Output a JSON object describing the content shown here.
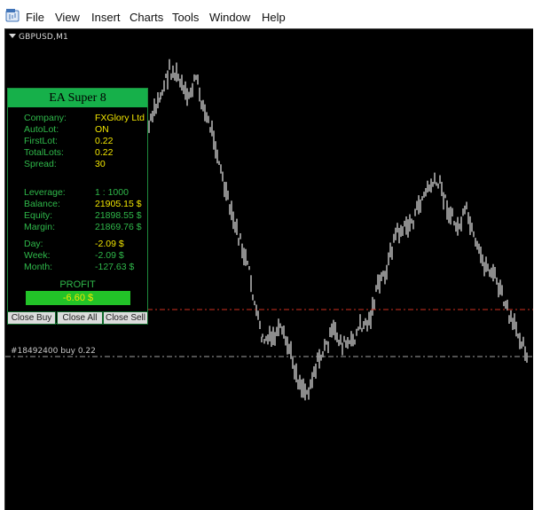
{
  "menu": {
    "items": [
      "File",
      "View",
      "Insert",
      "Charts",
      "Tools",
      "Window",
      "Help"
    ],
    "icon": "app-chart-icon"
  },
  "chart": {
    "symbol": "GBPUSD,M1",
    "order_label": "#18492400 buy 0.22",
    "colors": {
      "background": "#000000",
      "candles": "#b0b0b0",
      "order_line": "#a0a0a0",
      "stop_line": "#d03020"
    }
  },
  "panel": {
    "title": "EA Super 8",
    "rows": [
      {
        "label": "Company:",
        "value": "FXGlory Ltd",
        "color": "yellow"
      },
      {
        "label": "AutoLot:",
        "value": "ON",
        "color": "yellow"
      },
      {
        "label": "FirstLot:",
        "value": "0.22",
        "color": "yellow"
      },
      {
        "label": "TotalLots:",
        "value": "0.22",
        "color": "yellow"
      },
      {
        "label": "Spread:",
        "value": "30",
        "color": "yellow"
      },
      {
        "label": "Leverage:",
        "value": "1 : 1000",
        "color": "green"
      },
      {
        "label": "Balance:",
        "value": "21905.15 $",
        "color": "yellow"
      },
      {
        "label": "Equity:",
        "value": "21898.55 $",
        "color": "green"
      },
      {
        "label": "Margin:",
        "value": "21869.76 $",
        "color": "green"
      },
      {
        "label": "Day:",
        "value": "-2.09 $",
        "color": "yellow"
      },
      {
        "label": "Week:",
        "value": "-2.09 $",
        "color": "green"
      },
      {
        "label": "Month:",
        "value": "-127.63 $",
        "color": "green"
      }
    ],
    "profit_label": "PROFIT",
    "profit_value": "-6.60 $",
    "buttons": {
      "close_buy": "Close Buy",
      "close_all": "Close All",
      "close_sell": "Close Sell"
    }
  }
}
